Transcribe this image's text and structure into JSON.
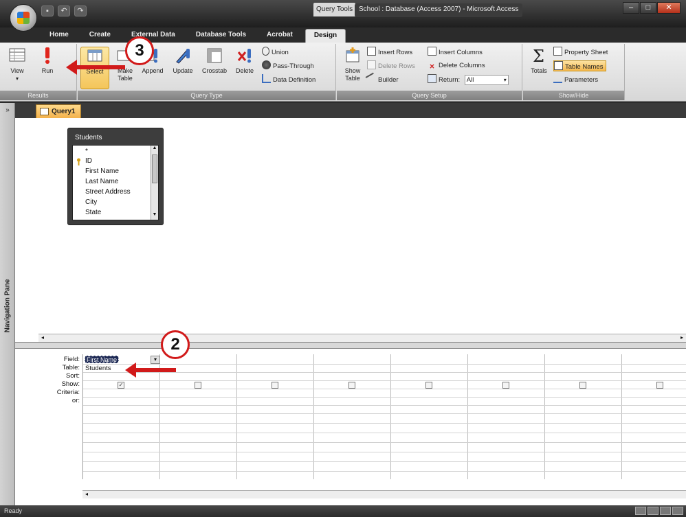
{
  "window": {
    "context_tab": "Query Tools",
    "title": "School : Database (Access 2007) - Microsoft Access"
  },
  "tabs": [
    {
      "label": "Home"
    },
    {
      "label": "Create"
    },
    {
      "label": "External Data"
    },
    {
      "label": "Database Tools"
    },
    {
      "label": "Acrobat"
    },
    {
      "label": "Design"
    }
  ],
  "ribbon": {
    "results": {
      "label": "Results",
      "view": "View",
      "run": "Run"
    },
    "query_type": {
      "label": "Query Type",
      "select": "Select",
      "make_table": "Make Table",
      "append": "Append",
      "update": "Update",
      "crosstab": "Crosstab",
      "delete": "Delete",
      "union": "Union",
      "pass_through": "Pass-Through",
      "data_definition": "Data Definition"
    },
    "query_setup": {
      "label": "Query Setup",
      "show_table": "Show Table",
      "insert_rows": "Insert Rows",
      "delete_rows": "Delete Rows",
      "builder": "Builder",
      "insert_columns": "Insert Columns",
      "delete_columns": "Delete Columns",
      "return_label": "Return:",
      "return_value": "All"
    },
    "show_hide": {
      "label": "Show/Hide",
      "totals": "Totals",
      "property_sheet": "Property Sheet",
      "table_names": "Table Names",
      "parameters": "Parameters"
    }
  },
  "nav_pane": {
    "label": "Navigation Pane",
    "expand": "»"
  },
  "document": {
    "tab_label": "Query1"
  },
  "table": {
    "name": "Students",
    "fields": [
      "*",
      "ID",
      "First Name",
      "Last Name",
      "Street Address",
      "City",
      "State"
    ]
  },
  "grid": {
    "row_labels": [
      "Field:",
      "Table:",
      "Sort:",
      "Show:",
      "Criteria:",
      "or:"
    ],
    "field_value": "First Name",
    "table_value": "Students",
    "show_first": "✓"
  },
  "annotations": {
    "step2": "2",
    "step3": "3"
  },
  "status": {
    "text": "Ready"
  }
}
